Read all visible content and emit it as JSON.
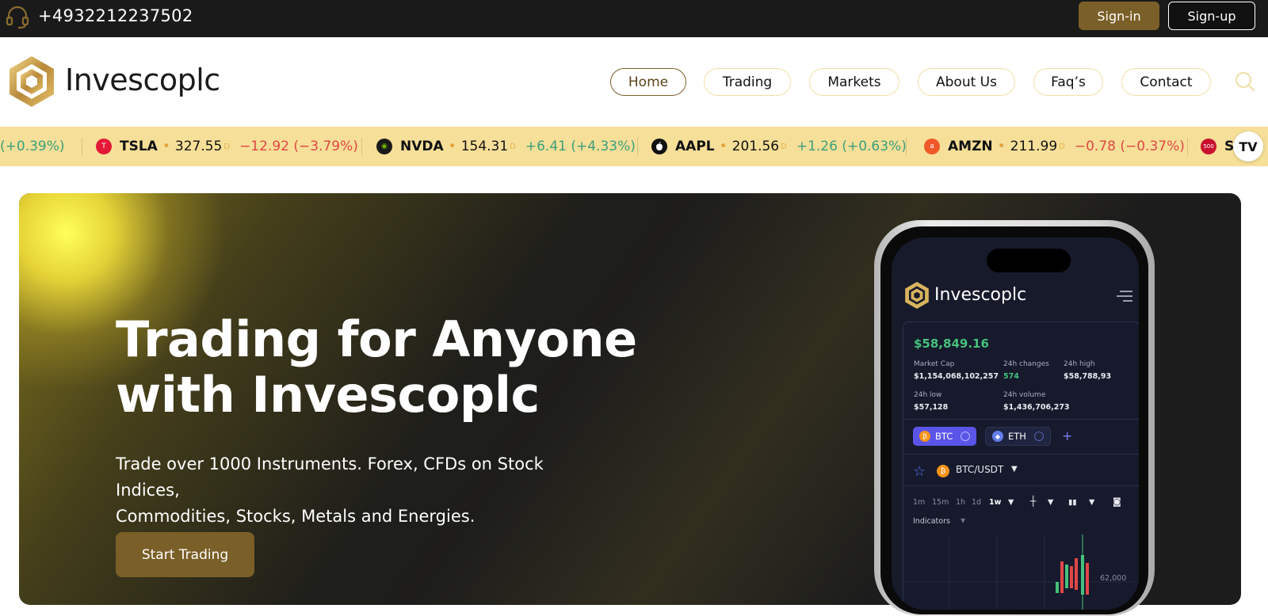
{
  "topbar": {
    "phone": "+4932212237502",
    "signin_label": "Sign-in",
    "signup_label": "Sign-up"
  },
  "nav": {
    "brand": "Invescoplc",
    "items": [
      {
        "label": "Home",
        "active": true
      },
      {
        "label": "Trading",
        "active": false
      },
      {
        "label": "Markets",
        "active": false
      },
      {
        "label": "About Us",
        "active": false
      },
      {
        "label": "Faq’s",
        "active": false
      },
      {
        "label": "Contact",
        "active": false
      }
    ]
  },
  "ticker": {
    "partial_left": "(+0.39%)",
    "items": [
      {
        "symbol": "TSLA",
        "price": "327.55",
        "suffix": "D",
        "change": "−12.92 (−3.79%)",
        "direction": "down",
        "logo_color": "#e31937",
        "logo_glyph": "T"
      },
      {
        "symbol": "NVDA",
        "price": "154.31",
        "suffix": "D",
        "change": "+6.41 (+4.33%)",
        "direction": "up",
        "logo_color": "#1a1a1a",
        "logo_glyph": "◉"
      },
      {
        "symbol": "AAPL",
        "price": "201.56",
        "suffix": "D",
        "change": "+1.26 (+0.63%)",
        "direction": "up",
        "logo_color": "#111111",
        "logo_glyph": ""
      },
      {
        "symbol": "AMZN",
        "price": "211.99",
        "suffix": "D",
        "change": "−0.78 (−0.37%)",
        "direction": "down",
        "logo_color": "#f0582a",
        "logo_glyph": "a"
      }
    ],
    "partial_right_symbol": "SP",
    "partial_right_logo": "500",
    "tv_badge": "TV"
  },
  "hero": {
    "title_line1": "Trading for Anyone",
    "title_line2": "with Invescoplc",
    "subtitle_line1": "Trade over 1000 Instruments. Forex, CFDs on Stock Indices,",
    "subtitle_line2": "Commodities, Stocks, Metals and Energies.",
    "cta_label": "Start Trading"
  },
  "phone_app": {
    "brand": "Invescoplc",
    "price": "$58,849.16",
    "stats": {
      "market_cap_label": "Market Cap",
      "market_cap": "$1,154,068,102,257",
      "change_label": "24h changes",
      "change": "574",
      "high_label": "24h high",
      "high": "$58,788,93",
      "low_label": "24h low",
      "low": "$57,128",
      "volume_label": "24h volume",
      "volume": "$1,436,706,273"
    },
    "chips": [
      {
        "label": "BTC",
        "coin_color": "#f7931a",
        "coin_glyph": "₿",
        "bg": "#5b54e8"
      },
      {
        "label": "ETH",
        "coin_color": "#627eea",
        "coin_glyph": "◆",
        "bg": "#1f2440"
      }
    ],
    "pair": "BTC/USDT",
    "timeframes": [
      "1m",
      "15m",
      "1h",
      "1d",
      "1w"
    ],
    "selected_timeframe": "1w",
    "indicators_label": "Indicators",
    "axis_value": "62,000"
  },
  "colors": {
    "gold": "#7a5f28",
    "ticker_bg": "#f6df98",
    "topbar_bg": "#1a1a1a",
    "positive": "#3c9f7c",
    "negative": "#e04747"
  }
}
